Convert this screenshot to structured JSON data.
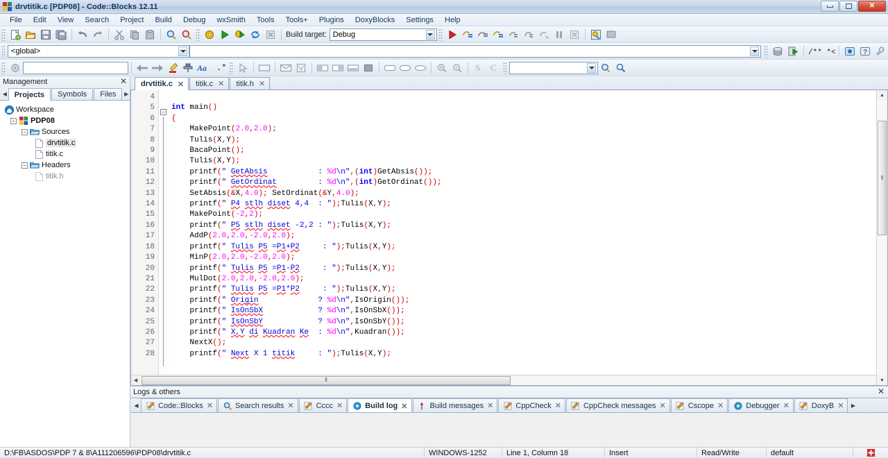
{
  "window": {
    "title": "drvtitik.c [PDP08] - Code::Blocks 12.11",
    "minimize_label": "Minimize",
    "maximize_label": "Maximize",
    "close_label": "✕"
  },
  "menubar": {
    "items": [
      "File",
      "Edit",
      "View",
      "Search",
      "Project",
      "Build",
      "Debug",
      "wxSmith",
      "Tools",
      "Tools+",
      "Plugins",
      "DoxyBlocks",
      "Settings",
      "Help"
    ]
  },
  "toolbar": {
    "build_target_label": "Build target:",
    "build_target_value": "Debug",
    "scope_value": "<global>",
    "search_value": ""
  },
  "management": {
    "title": "Management",
    "close_label": "✕",
    "tabs": [
      {
        "label": "Projects",
        "active": true
      },
      {
        "label": "Symbols",
        "active": false
      },
      {
        "label": "Files",
        "active": false
      }
    ],
    "tree": [
      {
        "label": "Workspace",
        "depth": 0
      },
      {
        "label": "PDP08",
        "depth": 1
      },
      {
        "label": "Sources",
        "depth": 2
      },
      {
        "label": "drvtitik.c",
        "depth": 3
      },
      {
        "label": "titik.c",
        "depth": 3
      },
      {
        "label": "Headers",
        "depth": 2
      },
      {
        "label": "titik.h",
        "depth": 3
      }
    ]
  },
  "editor": {
    "tabs": [
      {
        "label": "drvtitik.c",
        "active": true,
        "close": "✕"
      },
      {
        "label": "titik.c",
        "active": false,
        "close": "✕"
      },
      {
        "label": "titik.h",
        "active": false,
        "close": "✕"
      }
    ],
    "first_line": 4,
    "lines": [
      {
        "n": 4,
        "text": ""
      },
      {
        "n": 5,
        "text": "int main()"
      },
      {
        "n": 6,
        "text": "{"
      },
      {
        "n": 7,
        "text": "    MakePoint(2.0,2.0);"
      },
      {
        "n": 8,
        "text": "    Tulis(X,Y);"
      },
      {
        "n": 9,
        "text": "    BacaPoint();"
      },
      {
        "n": 10,
        "text": "    Tulis(X,Y);"
      },
      {
        "n": 11,
        "text": "    printf(\" GetAbsis           : %d\\n\",(int)GetAbsis());"
      },
      {
        "n": 12,
        "text": "    printf(\" GetOrdinat         : %d\\n\",(int)GetOrdinat());"
      },
      {
        "n": 13,
        "text": "    SetAbsis(&X,4.0); SetOrdinat(&Y,4.0);"
      },
      {
        "n": 14,
        "text": "    printf(\" P4 stlh diset 4,4  : \");Tulis(X,Y);"
      },
      {
        "n": 15,
        "text": "    MakePoint(-2,2);"
      },
      {
        "n": 16,
        "text": "    printf(\" P5 stlh diset -2,2 : \");Tulis(X,Y);"
      },
      {
        "n": 17,
        "text": "    AddP(2.0,2.0,-2.0,2.0);"
      },
      {
        "n": 18,
        "text": "    printf(\" Tulis P5 =P1+P2     : \");Tulis(X,Y);"
      },
      {
        "n": 19,
        "text": "    MinP(2.0,2.0,-2.0,2.0);"
      },
      {
        "n": 20,
        "text": "    printf(\" Tulis P5 =P1-P2     : \");Tulis(X,Y);"
      },
      {
        "n": 21,
        "text": "    MulDot(2.0,2.0,-2.0,2.0);"
      },
      {
        "n": 22,
        "text": "    printf(\" Tulis P5 =P1*P2     : \");Tulis(X,Y);"
      },
      {
        "n": 23,
        "text": "    printf(\" Origin             ? %d\\n\",IsOrigin());"
      },
      {
        "n": 24,
        "text": "    printf(\" IsOnSbX            ? %d\\n\",IsOnSbX());"
      },
      {
        "n": 25,
        "text": "    printf(\" IsOnSbY            ? %d\\n\",IsOnSbY());"
      },
      {
        "n": 26,
        "text": "    printf(\" X,Y di Kuadran Ke  : %d\\n\",Kuadran());"
      },
      {
        "n": 27,
        "text": "    NextX();"
      },
      {
        "n": 28,
        "text": "    printf(\" Next X 1 titik     : \");Tulis(X,Y);"
      }
    ]
  },
  "logs": {
    "title": "Logs & others",
    "close_label": "✕",
    "tabs": [
      {
        "label": "Code::Blocks",
        "active": false,
        "icon": "pencil-icon"
      },
      {
        "label": "Search results",
        "active": false,
        "icon": "magnifier-icon"
      },
      {
        "label": "Cccc",
        "active": false,
        "icon": "pencil-icon"
      },
      {
        "label": "Build log",
        "active": true,
        "icon": "gear-icon"
      },
      {
        "label": "Build messages",
        "active": false,
        "icon": "pin-icon"
      },
      {
        "label": "CppCheck",
        "active": false,
        "icon": "pencil-icon"
      },
      {
        "label": "CppCheck messages",
        "active": false,
        "icon": "pencil-icon"
      },
      {
        "label": "Cscope",
        "active": false,
        "icon": "pencil-icon"
      },
      {
        "label": "Debugger",
        "active": false,
        "icon": "gear-icon"
      },
      {
        "label": "DoxyB",
        "active": false,
        "icon": "pencil-icon"
      }
    ]
  },
  "statusbar": {
    "path": "D:\\FB\\ASDOS\\PDP 7 & 8\\A111206596\\PDP08\\drvtitik.c",
    "encoding": "WINDOWS-1252",
    "caret": "Line 1, Column 18",
    "mode": "Insert",
    "blank": "",
    "access": "Read/Write",
    "profile": "default"
  }
}
